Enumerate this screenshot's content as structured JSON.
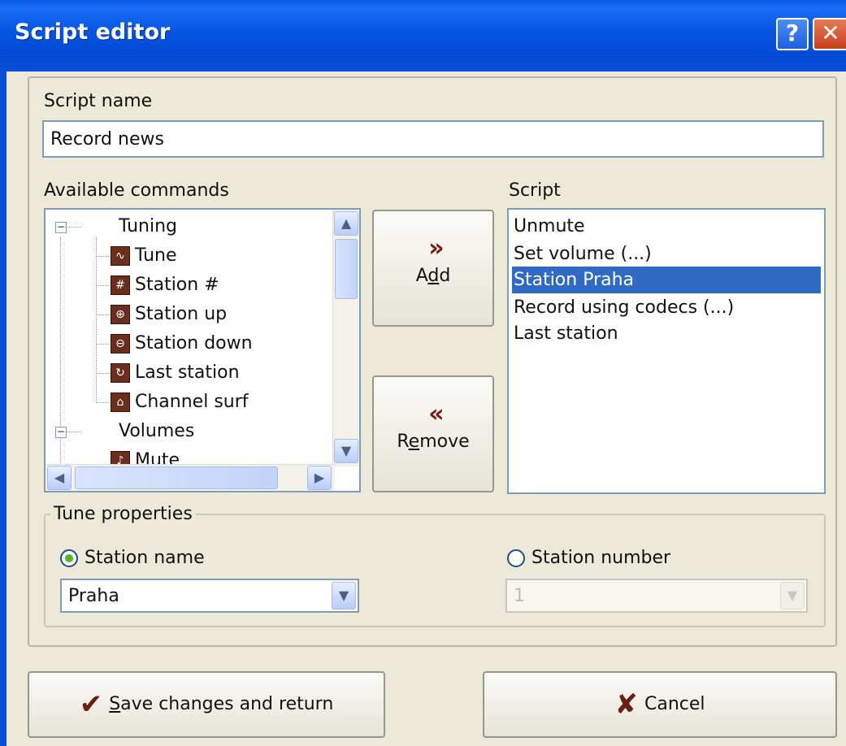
{
  "window": {
    "title": "Script editor",
    "help_glyph": "?",
    "close_glyph": "✕"
  },
  "script_name": {
    "label": "Script name",
    "value": "Record news"
  },
  "available_commands": {
    "label": "Available commands",
    "groups": [
      {
        "name": "Tuning",
        "items": [
          {
            "label": "Tune",
            "icon": "tune-icon"
          },
          {
            "label": "Station #",
            "icon": "station-number-icon"
          },
          {
            "label": "Station up",
            "icon": "station-up-icon"
          },
          {
            "label": "Station down",
            "icon": "station-down-icon"
          },
          {
            "label": "Last station",
            "icon": "last-station-icon"
          },
          {
            "label": "Channel surf",
            "icon": "channel-surf-icon"
          }
        ]
      },
      {
        "name": "Volumes",
        "items": [
          {
            "label": "Mute",
            "icon": "mute-icon"
          }
        ]
      }
    ]
  },
  "buttons": {
    "add": {
      "pre": "A",
      "u": "d",
      "post": "d"
    },
    "remove": {
      "pre": "R",
      "u": "e",
      "post": "move"
    }
  },
  "script": {
    "label": "Script",
    "items": [
      "Unmute",
      "Set volume (...)",
      "Station Praha",
      "Record using codecs (...)",
      "Last station"
    ],
    "selected_index": 2
  },
  "tune_properties": {
    "title": "Tune properties",
    "station_name": {
      "label": "Station name",
      "selected": true,
      "value": "Praha"
    },
    "station_number": {
      "label": "Station number",
      "selected": false,
      "value": "1"
    }
  },
  "footer": {
    "save": {
      "u": "S",
      "rest": "ave changes and return"
    },
    "cancel": {
      "label": "Cancel"
    }
  },
  "colors": {
    "titlebar": "#0a4fd8",
    "selection": "#316ac5",
    "dialog_bg": "#ece9d8"
  }
}
